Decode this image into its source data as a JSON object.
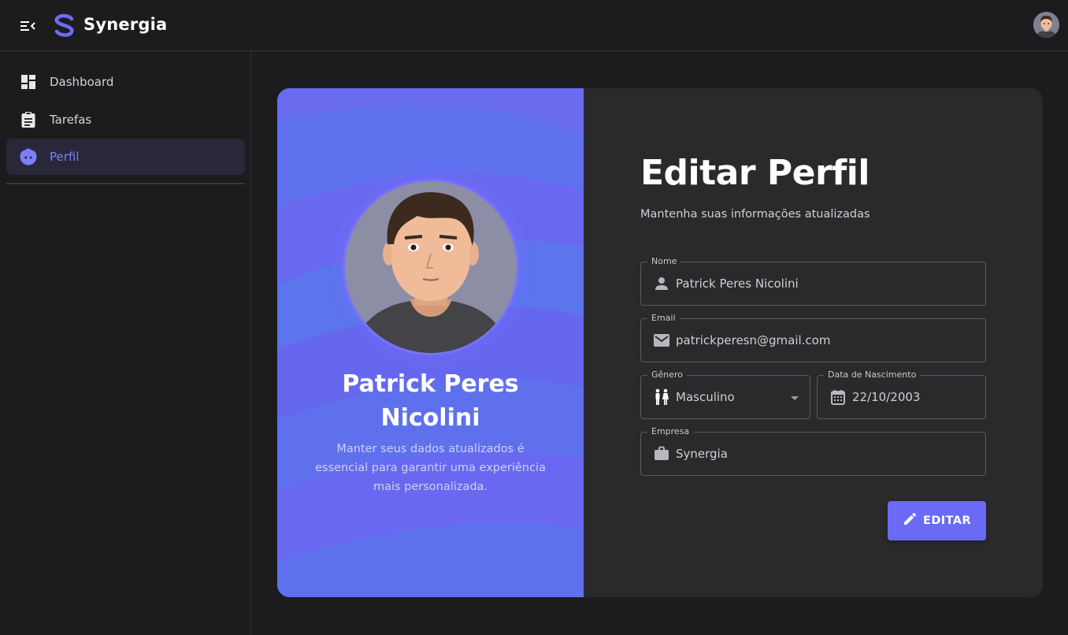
{
  "app": {
    "brand": "Synergia"
  },
  "sidebar": {
    "items": [
      {
        "label": "Dashboard",
        "icon": "dashboard-icon",
        "active": false
      },
      {
        "label": "Tarefas",
        "icon": "clipboard-icon",
        "active": false
      },
      {
        "label": "Perfil",
        "icon": "face-icon",
        "active": true
      }
    ]
  },
  "profile": {
    "name": "Patrick Peres Nicolini",
    "description": "Manter seus dados atualizados é essencial para garantir uma experiência mais personalizada."
  },
  "form": {
    "title": "Editar Perfil",
    "subtitle": "Mantenha suas informações atualizadas",
    "fields": {
      "name": {
        "label": "Nome",
        "value": "Patrick Peres Nicolini",
        "icon": "person-icon"
      },
      "email": {
        "label": "Email",
        "value": "patrickperesn@gmail.com",
        "icon": "mail-icon"
      },
      "gender": {
        "label": "Gênero",
        "value": "Masculino",
        "icon": "wc-icon"
      },
      "birthdate": {
        "label": "Data de Nascimento",
        "value": "22/10/2003",
        "icon": "calendar-icon"
      },
      "company": {
        "label": "Empresa",
        "value": "Synergia",
        "icon": "briefcase-icon"
      }
    },
    "submit_label": "EDITAR"
  },
  "colors": {
    "accent": "#6a6af4",
    "panel": "#6566ee",
    "background": "#1c1c1f",
    "card": "#2a2a2d"
  }
}
